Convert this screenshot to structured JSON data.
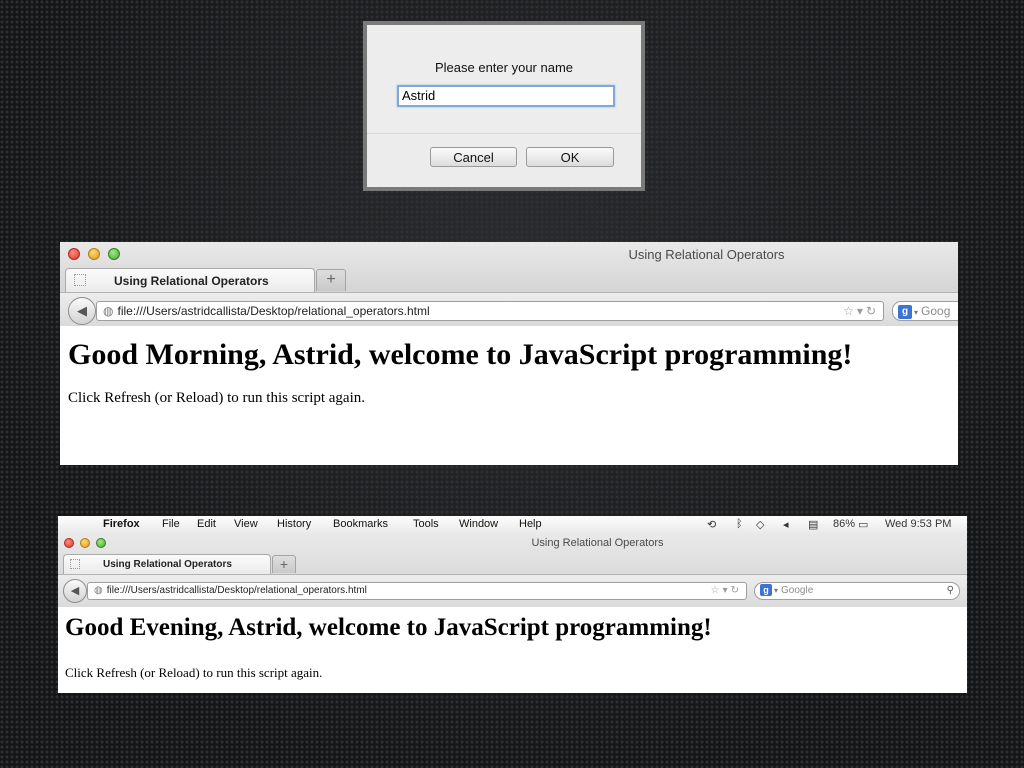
{
  "dialog": {
    "message": "Please enter your name",
    "input_value": "Astrid",
    "cancel_label": "Cancel",
    "ok_label": "OK"
  },
  "browser_top": {
    "window_title": "Using Relational Operators",
    "tab_label": "Using Relational Operators",
    "new_tab_icon": "+",
    "url": "file:///Users/astridcallista/Desktop/relational_operators.html",
    "search_placeholder": "Goog",
    "heading": "Good Morning, Astrid, welcome to JavaScript programming!",
    "paragraph": "Click Refresh (or Reload) to run this script again."
  },
  "menubar": {
    "apple_icon": "apple-logo",
    "items": [
      "Firefox",
      "File",
      "Edit",
      "View",
      "History",
      "Bookmarks",
      "Tools",
      "Window",
      "Help"
    ],
    "battery": "86%",
    "clock": "Wed 9:53 PM"
  },
  "browser_bottom": {
    "window_title": "Using Relational Operators",
    "tab_label": "Using Relational Operators",
    "new_tab_icon": "+",
    "url": "file:///Users/astridcallista/Desktop/relational_operators.html",
    "search_placeholder": "Google",
    "heading": "Good Evening, Astrid, welcome to JavaScript programming!",
    "paragraph": "Click Refresh (or Reload) to run this script again."
  },
  "colors": {
    "traffic_red": "#d8352b",
    "traffic_yellow": "#d99a1a",
    "traffic_green": "#3fa82c",
    "focus_ring": "#7fa8d8",
    "google_badge": "#3d74d4"
  }
}
